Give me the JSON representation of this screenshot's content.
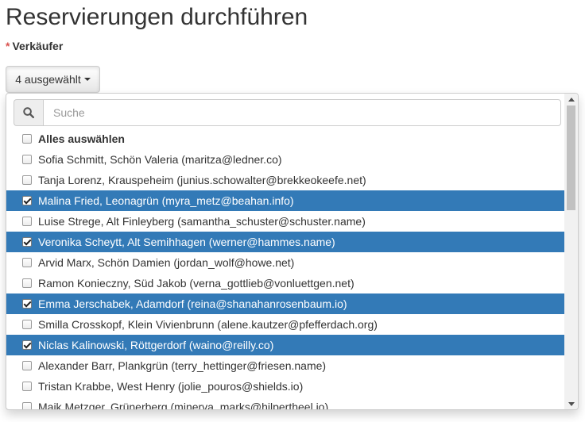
{
  "page": {
    "title": "Reservierungen durchführen"
  },
  "field": {
    "required_marker": "*",
    "label": "Verkäufer"
  },
  "dropdown": {
    "button_label": "4 ausgewählt"
  },
  "search": {
    "placeholder": "Suche",
    "value": ""
  },
  "options": [
    {
      "label": "Alles auswählen",
      "checked": false,
      "select_all": true
    },
    {
      "label": "Sofia Schmitt, Schön Valeria (maritza@ledner.co)",
      "checked": false
    },
    {
      "label": "Tanja Lorenz, Krauspeheim (junius.schowalter@brekkeokeefe.net)",
      "checked": false
    },
    {
      "label": "Malina Fried, Leonagrün (myra_metz@beahan.info)",
      "checked": true
    },
    {
      "label": "Luise Strege, Alt Finleyberg (samantha_schuster@schuster.name)",
      "checked": false
    },
    {
      "label": "Veronika Scheytt, Alt Semihhagen (werner@hammes.name)",
      "checked": true
    },
    {
      "label": "Arvid Marx, Schön Damien (jordan_wolf@howe.net)",
      "checked": false
    },
    {
      "label": "Ramon Konieczny, Süd Jakob (verna_gottlieb@vonluettgen.net)",
      "checked": false
    },
    {
      "label": "Emma Jerschabek, Adamdorf (reina@shanahanrosenbaum.io)",
      "checked": true
    },
    {
      "label": "Smilla Crosskopf, Klein Vivienbrunn (alene.kautzer@pfefferdach.org)",
      "checked": false
    },
    {
      "label": "Niclas Kalinowski, Röttgerdorf (waino@reilly.co)",
      "checked": true
    },
    {
      "label": "Alexander Barr, Plankgrün (terry_hettinger@friesen.name)",
      "checked": false
    },
    {
      "label": "Tristan Krabbe, West Henry (jolie_pouros@shields.io)",
      "checked": false
    },
    {
      "label": "Maik Metzger, Grünerberg (minerva_marks@hilpertheel.io)",
      "checked": false
    }
  ],
  "colors": {
    "selected_background": "#337ab7",
    "required": "#d9534f"
  },
  "icons": {
    "search": "search-icon",
    "caret": "caret-down-icon",
    "checkbox": "checkbox-icon"
  }
}
